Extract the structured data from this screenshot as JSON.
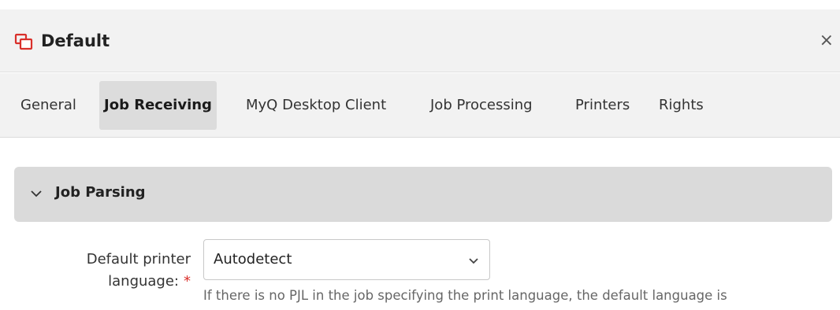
{
  "header": {
    "title": "Default",
    "close_label": "×",
    "title_icon": "printer-queue-icon"
  },
  "tabs": [
    {
      "label": "General",
      "active": false
    },
    {
      "label": "Job Receiving",
      "active": true
    },
    {
      "label": "MyQ Desktop Client",
      "active": false
    },
    {
      "label": "Job Processing",
      "active": false
    },
    {
      "label": "Printers",
      "active": false
    },
    {
      "label": "Rights",
      "active": false
    }
  ],
  "section": {
    "title": "Job Parsing",
    "expanded": true
  },
  "field": {
    "label": "Default printer language:",
    "label_line1": "Default printer",
    "label_line2": "language:",
    "required_marker": "*",
    "value": "Autodetect",
    "help": "If there is no PJL in the job specifying the print language, the default language is"
  },
  "colors": {
    "accent_icon": "#d9302b",
    "required": "#d9302b",
    "active_tab_bg": "#dcdcdc",
    "section_bg": "#dadada"
  }
}
